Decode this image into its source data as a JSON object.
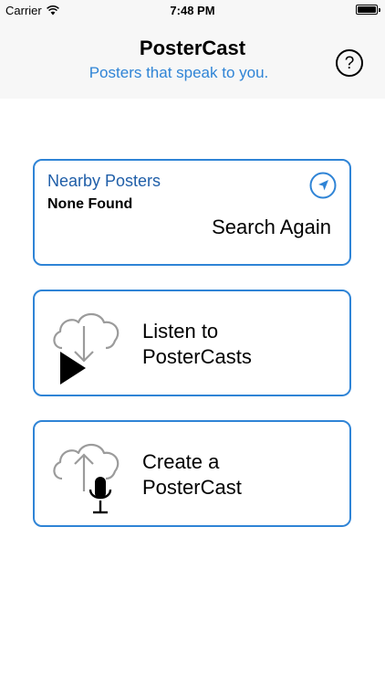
{
  "status_bar": {
    "carrier": "Carrier",
    "time": "7:48 PM"
  },
  "header": {
    "title": "PosterCast",
    "subtitle": "Posters that speak to you.",
    "help_label": "?"
  },
  "nearby": {
    "title": "Nearby Posters",
    "status": "None Found",
    "action": "Search Again",
    "icon": "location-arrow-icon"
  },
  "listen": {
    "line1": "Listen to",
    "line2": "PosterCasts",
    "icon": "cloud-download-play-icon"
  },
  "create": {
    "line1": "Create a",
    "line2": "PosterCast",
    "icon": "cloud-upload-microphone-icon"
  },
  "colors": {
    "accent": "#2f84d6",
    "nearby_title": "#1f5ea8",
    "header_bg": "#f7f7f7",
    "icon_gray": "#9b9b9b"
  }
}
